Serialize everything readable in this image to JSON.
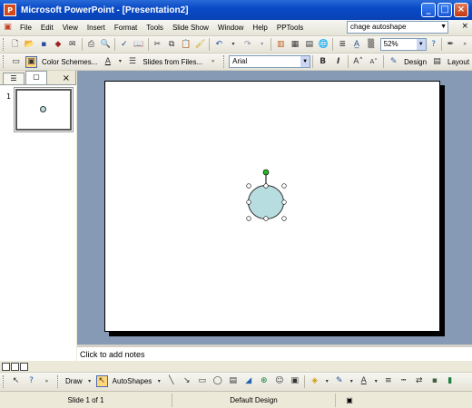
{
  "window": {
    "title": "Microsoft PowerPoint - [Presentation2]",
    "minimize": "_",
    "maximize": "□",
    "close": "×"
  },
  "menu": {
    "items": [
      {
        "label": "File"
      },
      {
        "label": "Edit"
      },
      {
        "label": "View"
      },
      {
        "label": "Insert"
      },
      {
        "label": "Format"
      },
      {
        "label": "Tools"
      },
      {
        "label": "Slide Show"
      },
      {
        "label": "Window"
      },
      {
        "label": "Help"
      },
      {
        "label": "PPTools"
      }
    ],
    "ask_box_value": "chage autoshape"
  },
  "standard_toolbar": {
    "zoom_value": "52%"
  },
  "formatting_toolbar": {
    "color_schemes_label": "Color Schemes...",
    "slides_from_files_label": "Slides from Files...",
    "font_value": "Arial",
    "bold_label": "B",
    "italic_label": "I",
    "design_label": "Design",
    "layout_label": "Layout"
  },
  "slides_pane": {
    "slide_number": "1",
    "close_label": "×"
  },
  "notes": {
    "placeholder": "Click to add notes"
  },
  "drawing_toolbar": {
    "draw_label": "Draw",
    "autoshapes_label": "AutoShapes"
  },
  "status": {
    "slide_info": "Slide 1 of 1",
    "design": "Default Design"
  },
  "colors": {
    "titlebar": "#0a4ac6",
    "shape_fill": "#b8dde0",
    "editor_background": "#879ab5",
    "rotation_handle": "#28b428"
  }
}
